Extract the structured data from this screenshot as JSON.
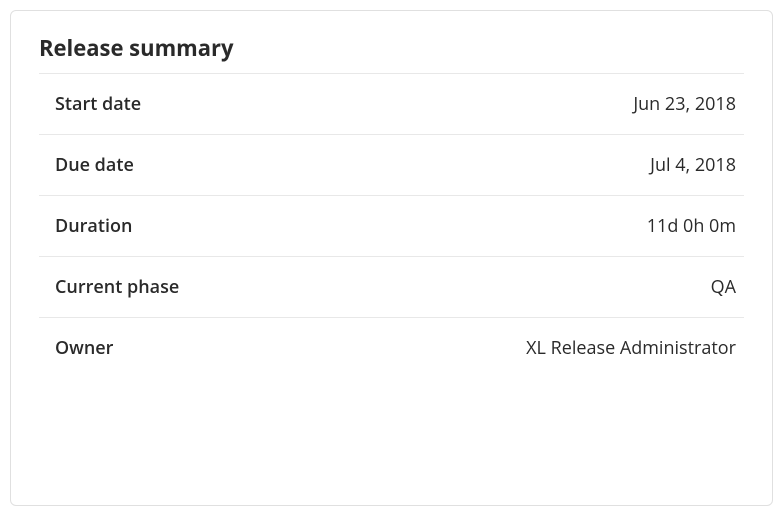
{
  "title": "Release summary",
  "rows": [
    {
      "label": "Start date",
      "value": "Jun 23, 2018"
    },
    {
      "label": "Due date",
      "value": "Jul 4, 2018"
    },
    {
      "label": "Duration",
      "value": "11d 0h 0m"
    },
    {
      "label": "Current phase",
      "value": "QA"
    },
    {
      "label": "Owner",
      "value": "XL Release Administrator"
    }
  ]
}
